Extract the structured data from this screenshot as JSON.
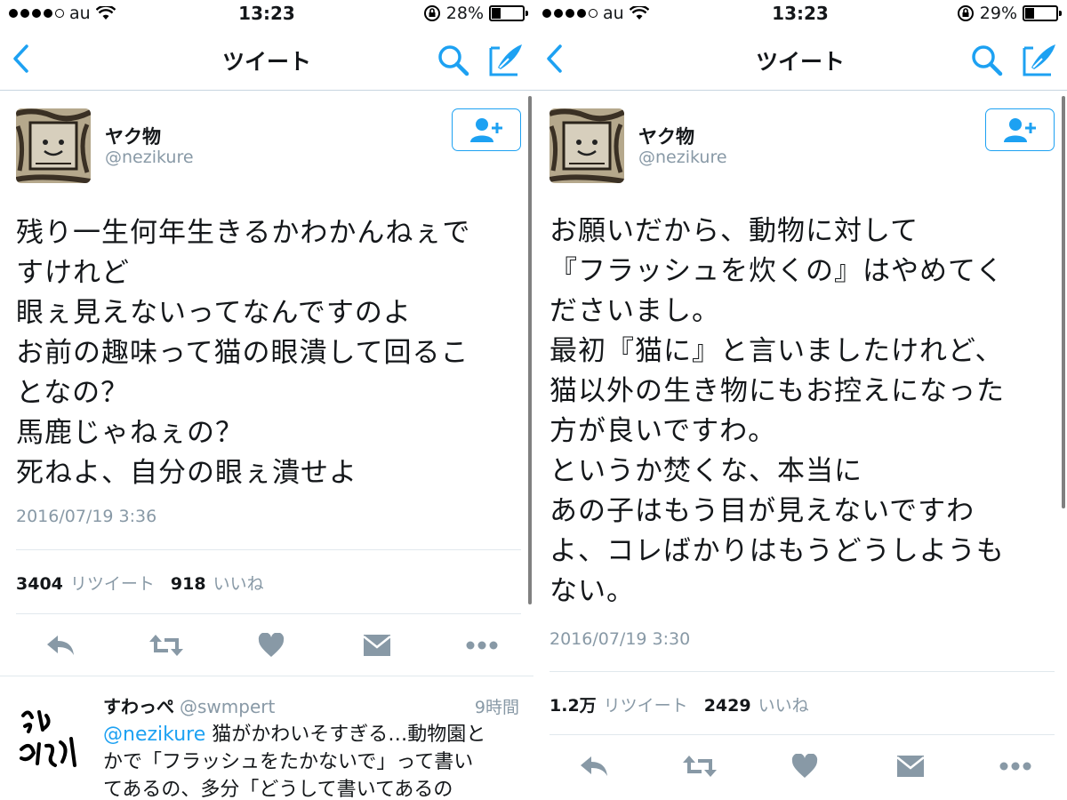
{
  "colors": {
    "accent": "#1da1f2",
    "secondary_text": "#8899a6",
    "divider": "#e1e8ed"
  },
  "left": {
    "status": {
      "carrier": "au",
      "time": "13:23",
      "battery": "28%",
      "battery_fraction": 0.28
    },
    "nav": {
      "title": "ツイート",
      "back_icon": "chevron-left-icon",
      "search_icon": "search-icon",
      "compose_icon": "compose-icon"
    },
    "author": {
      "name": "ヤク物",
      "handle": "@nezikure"
    },
    "tweet_lines": [
      "残り一生何年生きるかわかんねぇで",
      "すけれど",
      "眼ぇ見えないってなんですのよ",
      "お前の趣味って猫の眼潰して回るこ",
      "となの？",
      "馬鹿じゃねぇの？",
      "死ねよ、自分の眼ぇ潰せよ"
    ],
    "timestamp": "2016/07/19 3:36",
    "stats": {
      "retweets": "3404",
      "retweets_label": "リツイート",
      "likes": "918",
      "likes_label": "いいね"
    },
    "reply": {
      "name": "すわっぺ",
      "handle": "@swmpert",
      "time": "9時間",
      "mention": "@nezikure",
      "text_first": " 猫がかわいそすぎる…動物園と",
      "text_line2": "かで「フラッシュをたかないで」って書い",
      "text_line3": "てあるの、多分「どうして書いてあるの"
    }
  },
  "right": {
    "status": {
      "carrier": "au",
      "time": "13:23",
      "battery": "29%",
      "battery_fraction": 0.29
    },
    "nav": {
      "title": "ツイート"
    },
    "author": {
      "name": "ヤク物",
      "handle": "@nezikure"
    },
    "tweet_lines": [
      "お願いだから、動物に対して",
      "『フラッシュを炊くの』はやめてく",
      "ださいまし。",
      "最初『猫に』と言いましたけれど、",
      "猫以外の生き物にもお控えになった",
      "方が良いですわ。",
      "というか焚くな、本当に",
      "あの子はもう目が見えないですわ",
      "よ、コレばかりはもうどうしようも",
      "ない。"
    ],
    "timestamp": "2016/07/19 3:30",
    "stats": {
      "retweets": "1.2万",
      "retweets_label": "リツイート",
      "likes": "2429",
      "likes_label": "いいね"
    }
  }
}
